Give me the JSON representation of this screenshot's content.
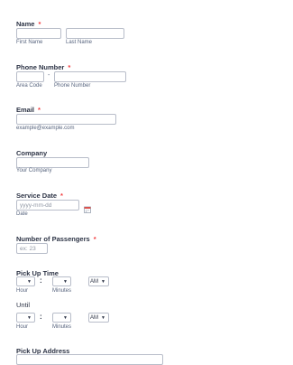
{
  "required_mark": "*",
  "name": {
    "label": "Name",
    "first_sub": "First Name",
    "last_sub": "Last Name",
    "first_value": "",
    "last_value": ""
  },
  "phone": {
    "label": "Phone Number",
    "separator": "-",
    "area_sub": "Area Code",
    "number_sub": "Phone Number"
  },
  "email": {
    "label": "Email",
    "sub": "example@example.com"
  },
  "company": {
    "label": "Company",
    "sub": "Your Company"
  },
  "service_date": {
    "label": "Service Date",
    "placeholder": "yyyy-mm-dd",
    "sub": "Date",
    "icon": "calendar-icon"
  },
  "passengers": {
    "label": "Number of Passengers",
    "placeholder": "ex: 23"
  },
  "pickup_time": {
    "label": "Pick Up Time",
    "separator": ":",
    "hour_sub": "Hour",
    "minutes_sub": "Minutes",
    "hour_value": "",
    "minutes_value": "",
    "ampm_value": "AM",
    "caret": "▼"
  },
  "until": {
    "label": "Until",
    "separator": ":",
    "hour_sub": "Hour",
    "minutes_sub": "Minutes",
    "hour_value": "",
    "minutes_value": "",
    "ampm_value": "AM",
    "caret": "▼"
  },
  "pickup_address": {
    "label": "Pick Up Address"
  }
}
